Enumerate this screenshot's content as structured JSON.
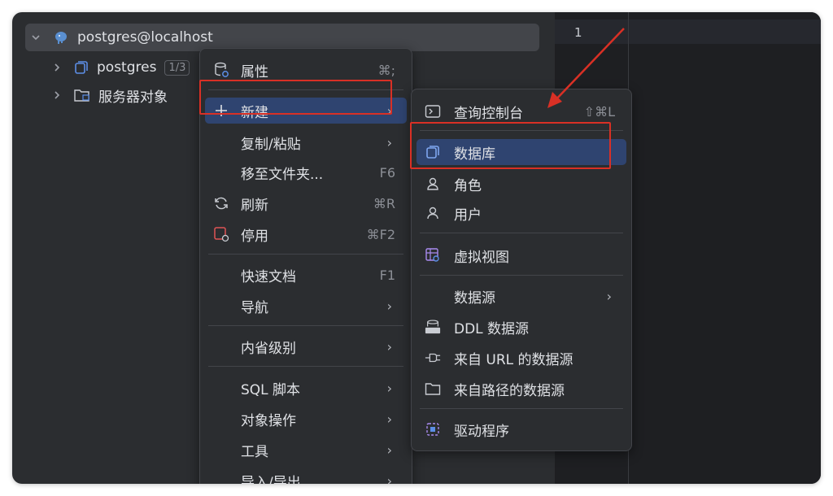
{
  "tree": {
    "root_label": "postgres@localhost",
    "items": [
      {
        "label": "postgres",
        "badge": "1/3"
      },
      {
        "label": "服务器对象"
      }
    ]
  },
  "editor": {
    "line_number": "1"
  },
  "context_menu": [
    {
      "label": "属性",
      "shortcut": "⌘;",
      "icon": "database-settings-icon"
    },
    {
      "label": "新建",
      "submenu": true,
      "selected": true,
      "icon": "plus-icon"
    },
    {
      "label": "复制/粘贴",
      "submenu": true
    },
    {
      "label": "移至文件夹...",
      "shortcut": "F6"
    },
    {
      "label": "刷新",
      "shortcut": "⌘R",
      "icon": "refresh-icon"
    },
    {
      "label": "停用",
      "shortcut": "⌘F2",
      "icon": "deactivate-icon"
    },
    {
      "label": "快速文档",
      "shortcut": "F1"
    },
    {
      "label": "导航",
      "submenu": true
    },
    {
      "label": "内省级别",
      "submenu": true
    },
    {
      "label": "SQL 脚本",
      "submenu": true
    },
    {
      "label": "对象操作",
      "submenu": true
    },
    {
      "label": "工具",
      "submenu": true
    },
    {
      "label": "导入/导出",
      "submenu": true
    }
  ],
  "submenu": [
    {
      "label": "查询控制台",
      "shortcut": "⇧⌘L",
      "icon": "console-icon"
    },
    {
      "label": "数据库",
      "selected": true,
      "icon": "database-icon"
    },
    {
      "label": "角色",
      "icon": "role-icon"
    },
    {
      "label": "用户",
      "icon": "user-icon"
    },
    {
      "label": "虚拟视图",
      "icon": "virtual-view-icon"
    },
    {
      "label": "数据源",
      "submenu": true
    },
    {
      "label": "DDL 数据源",
      "icon": "ddl-icon"
    },
    {
      "label": "来自 URL 的数据源",
      "icon": "plug-icon"
    },
    {
      "label": "来自路径的数据源",
      "icon": "folder-icon"
    },
    {
      "label": "驱动程序",
      "icon": "driver-icon"
    }
  ],
  "annotation_color": "#d93025",
  "selection_color": "#2f4470"
}
